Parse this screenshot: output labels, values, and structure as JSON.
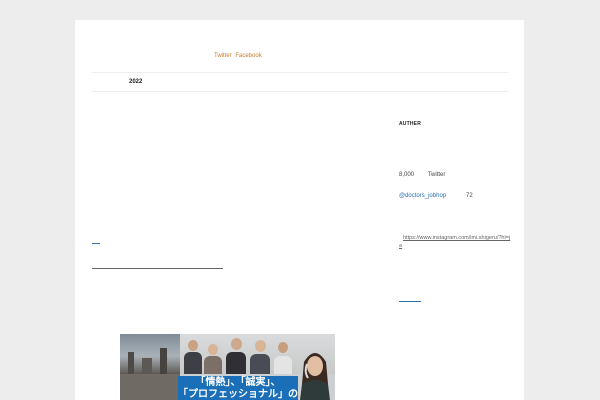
{
  "header": {
    "social_links": [
      "Twitter",
      "Facebook"
    ]
  },
  "archive": {
    "year": "2022"
  },
  "sidebar": {
    "title": "AUTHER",
    "followers_count": "8,000",
    "followers_label": "Twitter",
    "handle": "@doctors_jobhop",
    "handle_count": "72",
    "instagram_url": "https://www.instagram.com/imi.shigeru/?hl=ja"
  },
  "banner": {
    "line1": "「情熱」、「誠実」、",
    "line2": "「プロフェッショナル」の追求"
  },
  "colors": {
    "background": "#ededed",
    "link": "#2a6fb0",
    "social": "#c87a2a",
    "banner_blue": "#1b6fb8"
  }
}
